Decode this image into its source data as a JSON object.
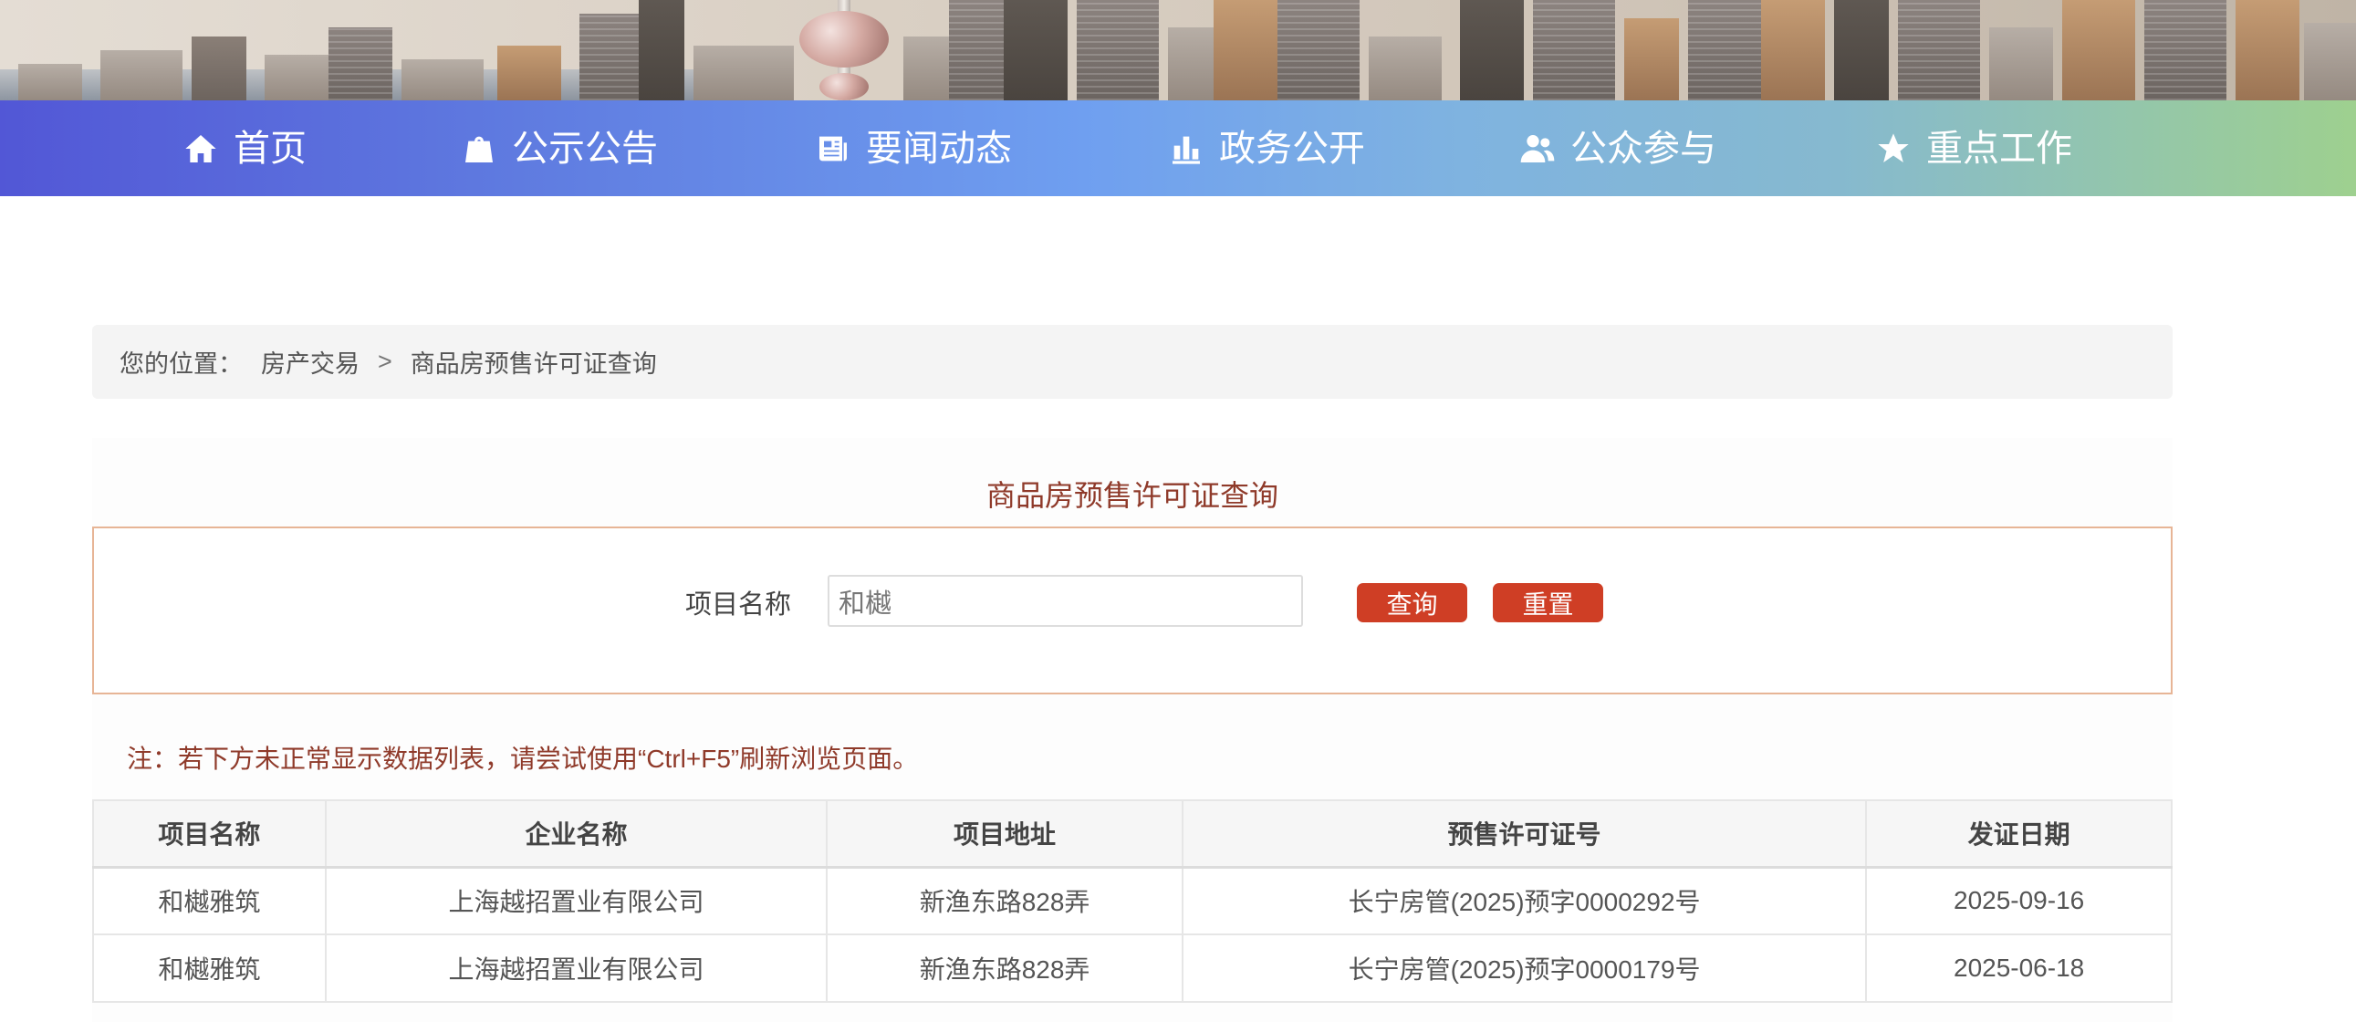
{
  "nav": {
    "items": [
      {
        "label": "首页",
        "icon": "home-icon"
      },
      {
        "label": "公示公告",
        "icon": "notice-icon"
      },
      {
        "label": "要闻动态",
        "icon": "newspaper-icon"
      },
      {
        "label": "政务公开",
        "icon": "bar-chart-icon"
      },
      {
        "label": "公众参与",
        "icon": "users-icon"
      },
      {
        "label": "重点工作",
        "icon": "star-icon"
      }
    ],
    "gradient": [
      "#5257d6",
      "#6f9ff0",
      "#9ed08f"
    ]
  },
  "breadcrumb": {
    "prefix": "您的位置：",
    "level1": "房产交易",
    "separator": ">",
    "current": "商品房预售许可证查询"
  },
  "main": {
    "title": "商品房预售许可证查询",
    "search": {
      "label": "项目名称",
      "value": "和樾",
      "placeholder": ""
    },
    "buttons": {
      "query": "查询",
      "reset": "重置"
    },
    "note": "注：若下方未正常显示数据列表，请尝试使用“Ctrl+F5”刷新浏览页面。",
    "table": {
      "headers": [
        "项目名称",
        "企业名称",
        "项目地址",
        "预售许可证号",
        "发证日期"
      ],
      "rows": [
        [
          "和樾雅筑",
          "上海越招置业有限公司",
          "新渔东路828弄",
          "长宁房管(2025)预字0000292号",
          "2025-09-16"
        ],
        [
          "和樾雅筑",
          "上海越招置业有限公司",
          "新渔东路828弄",
          "长宁房管(2025)预字0000179号",
          "2025-06-18"
        ]
      ]
    }
  },
  "colors": {
    "accent": "#cf3e25",
    "title": "#8f3a2a",
    "search_border": "#e7b596"
  }
}
